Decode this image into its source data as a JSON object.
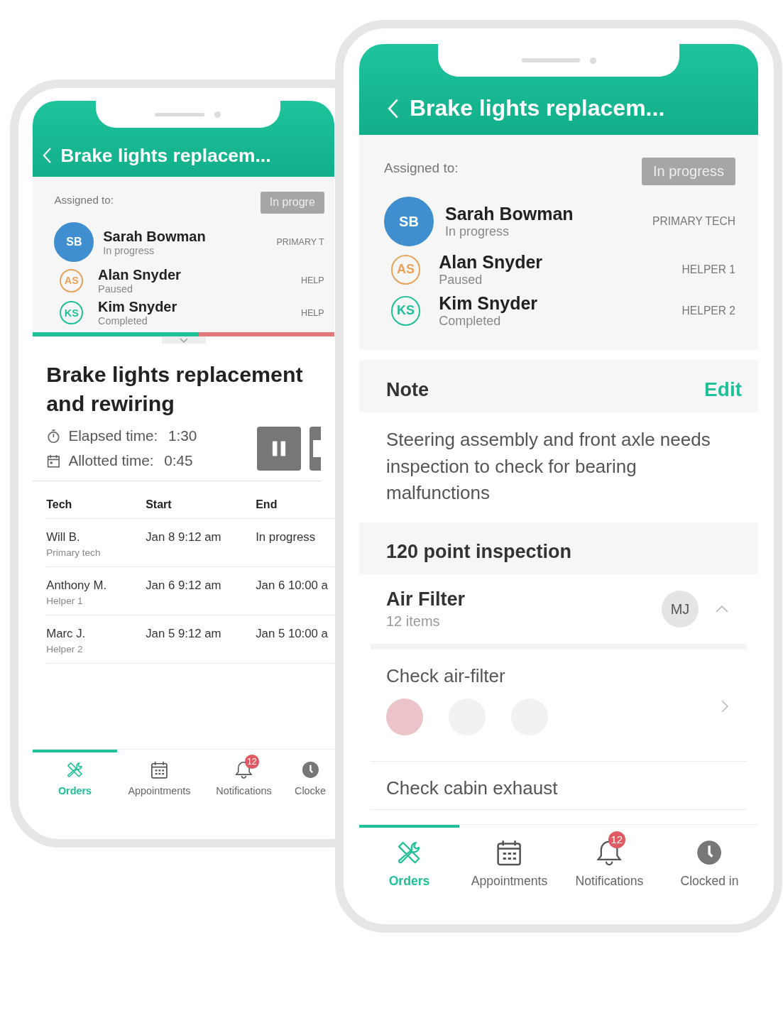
{
  "phones": [
    {
      "header": {
        "title": "Brake lights replacem..."
      },
      "assigned": {
        "label": "Assigned to:",
        "status": "In progre",
        "people": [
          {
            "initials": "SB",
            "name": "Sarah Bowman",
            "status": "In progress",
            "role": "PRIMARY T",
            "kind": "filled",
            "color": "#3f8ecf"
          },
          {
            "initials": "AS",
            "name": "Alan Snyder",
            "status": "Paused",
            "role": "HELP",
            "kind": "outline",
            "color": "#e8a25a"
          },
          {
            "initials": "KS",
            "name": "Kim Snyder",
            "status": "Completed",
            "role": "HELP",
            "kind": "outline",
            "color": "#1fbf98"
          }
        ]
      },
      "progress": {
        "level": 0.55
      },
      "task": {
        "title": "Brake lights replacement and rewiring",
        "times": [
          {
            "kind": "elapsed",
            "label": "Elapsed time:",
            "value": "1:30"
          },
          {
            "kind": "allotted",
            "label": "Allotted time:",
            "value": "0:45"
          }
        ]
      },
      "log": {
        "columns": [
          "Tech",
          "Start",
          "End"
        ],
        "rows": [
          {
            "tech": "Will B.",
            "role": "Primary tech",
            "start": "Jan 8 9:12 am",
            "end": "In progress"
          },
          {
            "tech": "Anthony M.",
            "role": "Helper 1",
            "start": "Jan 6 9:12 am",
            "end": "Jan 6 10:00 a"
          },
          {
            "tech": "Marc J.",
            "role": "Helper 2",
            "start": "Jan 5 9:12 am",
            "end": "Jan 5 10:00 a"
          }
        ]
      },
      "nav": [
        {
          "kind": "orders",
          "label": "Orders",
          "selected": true
        },
        {
          "kind": "appointments",
          "label": "Appointments",
          "selected": false
        },
        {
          "kind": "notifications",
          "label": "Notifications",
          "selected": false,
          "badge": "12"
        },
        {
          "kind": "clock",
          "label": "Clocke",
          "selected": false
        }
      ]
    },
    {
      "header": {
        "title": "Brake lights replacem..."
      },
      "assigned": {
        "label": "Assigned to:",
        "status": "In progress",
        "people": [
          {
            "initials": "SB",
            "name": "Sarah Bowman",
            "status": "In progress",
            "role": "PRIMARY TECH",
            "kind": "filled",
            "color": "#3f8ecf"
          },
          {
            "initials": "AS",
            "name": "Alan Snyder",
            "status": "Paused",
            "role": "HELPER 1",
            "kind": "outline",
            "color": "#e8a25a"
          },
          {
            "initials": "KS",
            "name": "Kim Snyder",
            "status": "Completed",
            "role": "HELPER 2",
            "kind": "outline",
            "color": "#1fbf98"
          }
        ]
      },
      "note": {
        "heading": "Note",
        "action": "Edit",
        "text": "Steering assembly and front axle needs inspection to check for bearing malfunctions"
      },
      "inspection": {
        "heading": "120 point inspection",
        "group": {
          "title": "Air Filter",
          "count": "12 items",
          "assignee": "MJ",
          "expanded": true
        },
        "items": [
          {
            "label": "Check air-filter",
            "options": [
              {
                "selected": true
              },
              {
                "selected": false
              },
              {
                "selected": false
              }
            ]
          },
          {
            "label": "Check cabin exhaust"
          }
        ]
      },
      "nav": [
        {
          "kind": "orders",
          "label": "Orders",
          "selected": true
        },
        {
          "kind": "appointments",
          "label": "Appointments",
          "selected": false
        },
        {
          "kind": "notifications",
          "label": "Notifications",
          "selected": false,
          "badge": "12"
        },
        {
          "kind": "clock",
          "label": "Clocked in",
          "selected": false
        }
      ]
    }
  ]
}
